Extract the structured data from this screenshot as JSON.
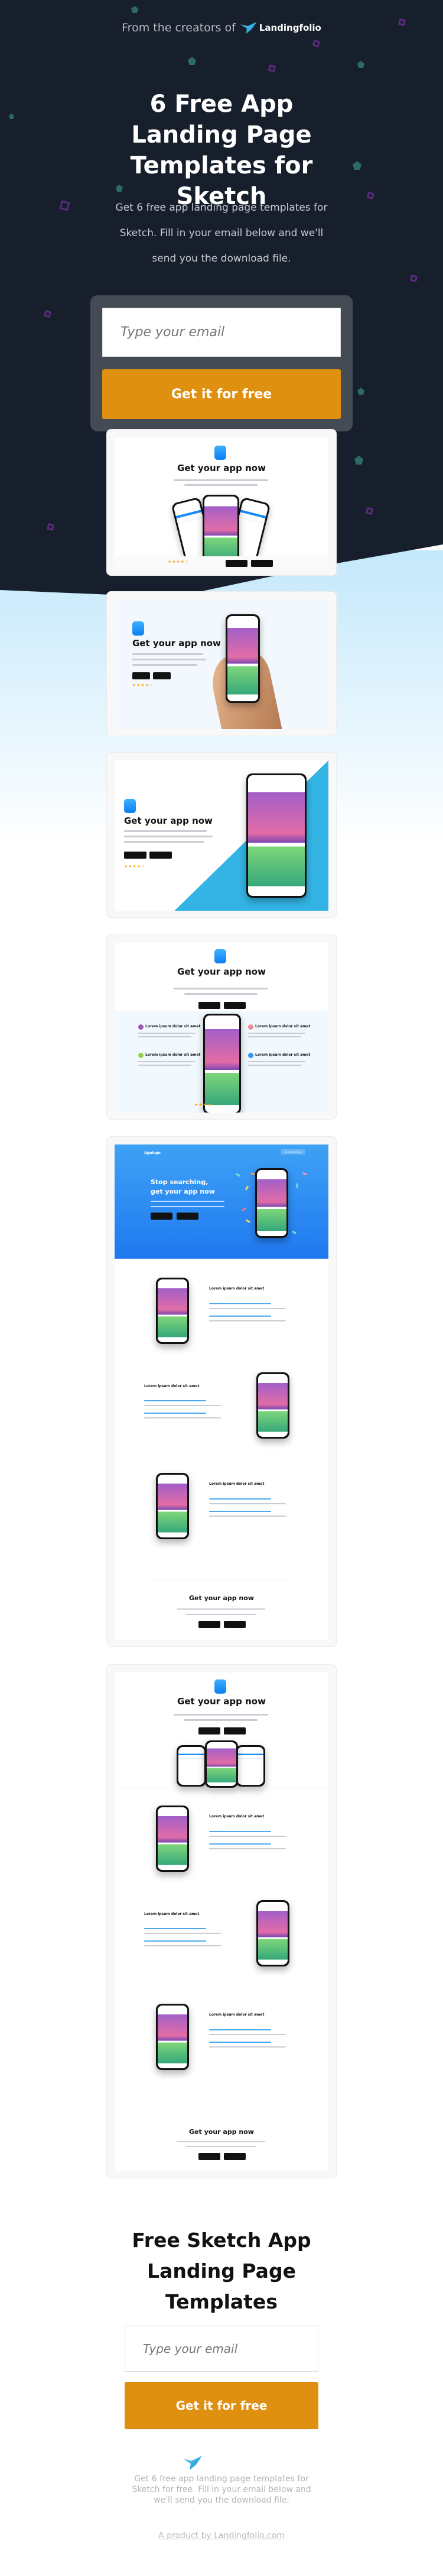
{
  "hero": {
    "from_text": "From the creators of",
    "brand": "Landingfolio",
    "title": "6 Free App Landing Page Templates for Sketch",
    "subtitle": "Get 6 free app landing page templates for Sketch. Fill in your email below and we'll send you the download file.",
    "email_placeholder": "Type your email",
    "button": "Get it for free"
  },
  "previews": [
    {
      "headline": "Get your app now"
    },
    {
      "headline": "Get your app now"
    },
    {
      "headline": "Get your app now"
    },
    {
      "headline": "Get your app now",
      "feature_heading": "Lorem ipsum dolor sit amet"
    },
    {
      "logo": "Applogo",
      "nav_button": "Download app",
      "headline": "Stop searching, get your app now",
      "row_heading": "Lorem ipsum dolor sit amet",
      "footer_headline": "Get your app now"
    },
    {
      "headline": "Get your app now",
      "row_heading": "Lorem ipsum dolor sit amet",
      "footer_headline": "Get your app now"
    }
  ],
  "footer": {
    "title": "Free Sketch App Landing Page Templates",
    "email_placeholder": "Type your email",
    "button": "Get it for free",
    "text": "Get 6 free app landing page templates for Sketch for free. Fill in your email below and we'll send you the download file.",
    "link": "A product by Landingfolio.com"
  },
  "colors": {
    "dark_bg": "#161f2b",
    "accent": "#e09010",
    "brand_blue": "#1a8cf5"
  }
}
